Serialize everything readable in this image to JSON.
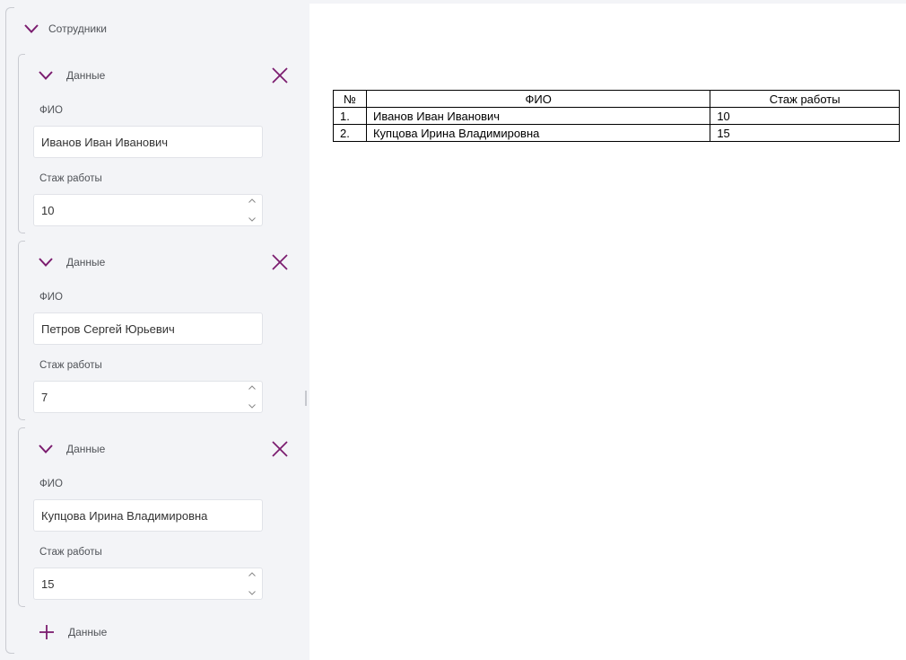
{
  "section": {
    "title": "Сотрудники"
  },
  "employees": [
    {
      "group_label": "Данные",
      "fio_label": "ФИО",
      "fio_value": "Иванов Иван Иванович",
      "exp_label": "Стаж работы",
      "exp_value": "10"
    },
    {
      "group_label": "Данные",
      "fio_label": "ФИО",
      "fio_value": "Петров Сергей Юрьевич",
      "exp_label": "Стаж работы",
      "exp_value": "7"
    },
    {
      "group_label": "Данные",
      "fio_label": "ФИО",
      "fio_value": "Купцова Ирина Владимировна",
      "exp_label": "Стаж работы",
      "exp_value": "15"
    }
  ],
  "add_label": "Данные",
  "preview_table": {
    "headers": [
      "№",
      "ФИО",
      "Стаж работы"
    ],
    "rows": [
      [
        "1.",
        "Иванов Иван Иванович",
        "10"
      ],
      [
        "2.",
        "Купцова Ирина Владимировна",
        "15"
      ]
    ]
  },
  "colors": {
    "accent": "#7b1c6f",
    "panel_bg": "#f3f4f7",
    "border": "#c9cbd1"
  },
  "icons": {
    "collapse": "chevron-down-icon",
    "remove": "close-icon",
    "add": "plus-icon",
    "stepper_up": "chevron-up-icon",
    "stepper_down": "chevron-down-icon"
  }
}
